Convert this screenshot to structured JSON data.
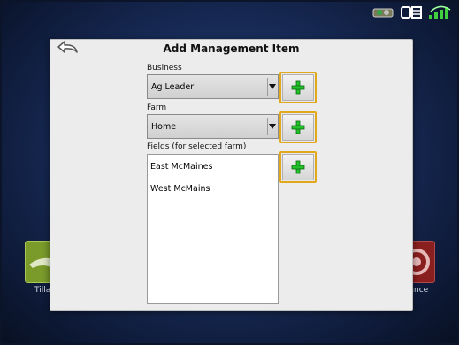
{
  "dialog": {
    "title": "Add Management Item",
    "business": {
      "label": "Business",
      "value": "Ag Leader"
    },
    "farm": {
      "label": "Farm",
      "value": "Home"
    },
    "fields": {
      "label": "Fields (for selected farm)",
      "items": [
        "East McMaines",
        "West McMains"
      ]
    }
  },
  "background_tiles": {
    "left_label": "Tilla",
    "right_label": "lance"
  },
  "colors": {
    "accent_border": "#e2a81c",
    "plus_green": "#22c02a",
    "background": "#1a2f5e"
  },
  "icons": {
    "back": "back-arrow-icon",
    "add": "plus-icon"
  }
}
